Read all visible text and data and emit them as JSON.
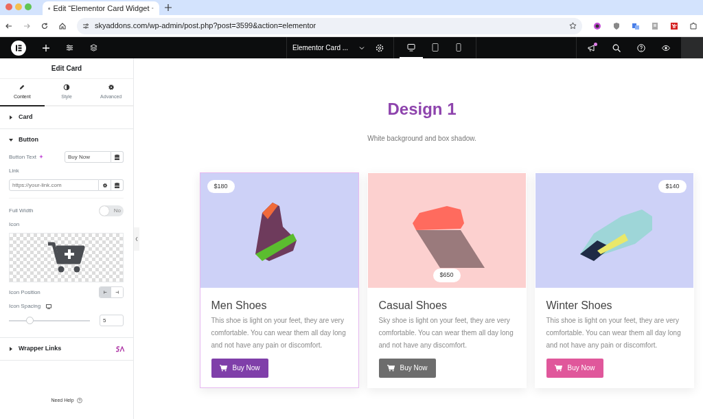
{
  "browser": {
    "tab_title": "Edit “Elementor Card Widget",
    "url": "skyaddons.com/wp-admin/post.php?post=3599&action=elementor"
  },
  "editor_bar": {
    "document_title": "Elementor Card ...",
    "devices": [
      {
        "kind": "desktop",
        "selected": true
      },
      {
        "kind": "tablet",
        "selected": false
      },
      {
        "kind": "mobile",
        "selected": false
      }
    ],
    "notification": true
  },
  "panel": {
    "title": "Edit Card",
    "tabs": [
      {
        "kind": "content",
        "label": "Content",
        "selected": true
      },
      {
        "kind": "style",
        "label": "Style",
        "selected": false
      },
      {
        "kind": "advanced",
        "label": "Advanced",
        "selected": false
      }
    ],
    "sections": [
      {
        "kind": "card",
        "label": "Card",
        "expanded": false
      },
      {
        "kind": "button",
        "label": "Button",
        "expanded": true
      },
      {
        "kind": "wrapper",
        "label": "Wrapper Links",
        "expanded": false
      }
    ],
    "button_text": {
      "label": "Button Text",
      "value": "Buy Now"
    },
    "link": {
      "label": "Link",
      "placeholder": "https://your-link.com"
    },
    "full_width": {
      "label": "Full Width",
      "on": false,
      "state_text": "No"
    },
    "icon": {
      "label": "Icon"
    },
    "icon_position": {
      "label": "Icon Position",
      "options": [
        {
          "kind": "start",
          "selected": true
        },
        {
          "kind": "end",
          "selected": false
        }
      ]
    },
    "icon_spacing": {
      "label": "Icon Spacing",
      "level": 0.25,
      "value": "5"
    },
    "need_help": "Need Help"
  },
  "canvas": {
    "heading": "Design 1",
    "subheading": "White background and box shadow.",
    "cards": [
      {
        "title": "Men Shoes",
        "text": "This shoe is light on your feet, they are very comfortable. You can wear them all day long and not have any pain or discomfort.",
        "price": "$180",
        "kind": "left",
        "color": "#7f3fa9",
        "button": "Buy Now",
        "selected": true
      },
      {
        "title": "Casual Shoes",
        "text": "Sky shoe is light on your feet, they are very comfortable. You can wear them all day long and not have any discomfort.",
        "price": "$650",
        "kind": "center",
        "color": "#6d6d6d",
        "button": "Buy Now",
        "selected": false
      },
      {
        "title": "Winter Shoes",
        "text": "This shoe is light on your feet, they are very comfortable. You can wear them all day long and not have any pain or discomfort.",
        "price": "$140",
        "kind": "right",
        "color": "#e0579b",
        "button": "Buy Now",
        "selected": false
      }
    ]
  }
}
